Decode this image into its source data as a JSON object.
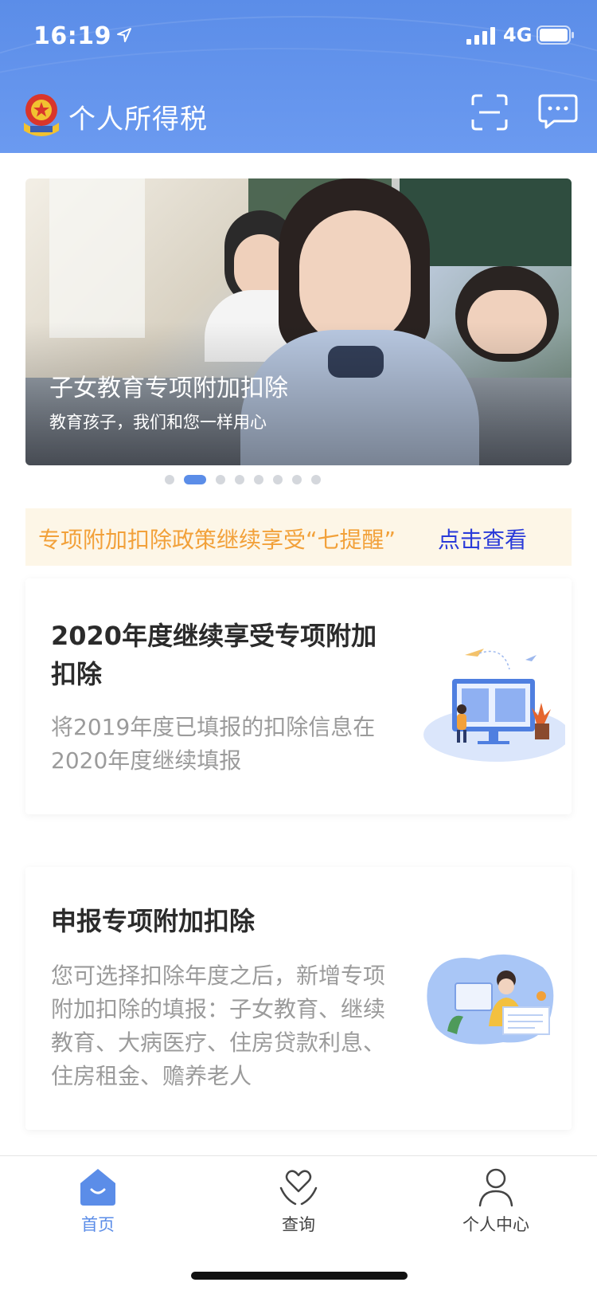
{
  "status_bar": {
    "time": "16:19",
    "network": "4G"
  },
  "app_bar": {
    "title": "个人所得税",
    "icons": [
      "emblem-icon",
      "scan-icon",
      "message-icon"
    ]
  },
  "banner": {
    "title": "子女教育专项附加扣除",
    "subtitle": "教育孩子，我们和您一样用心",
    "slide_count": 8,
    "active_slide_index": 1
  },
  "notice": {
    "text": "专项附加扣除政策继续享受“七提醒”",
    "link": "点击查看"
  },
  "cards": [
    {
      "title": "2020年度继续享受专项附加扣除",
      "description": "将2019年度已填报的扣除信息在2020年度继续填报"
    },
    {
      "title": "申报专项附加扣除",
      "description": "您可选择扣除年度之后，新增专项附加扣除的填报：子女教育、继续教育、大病医疗、住房贷款利息、住房租金、赡养老人"
    }
  ],
  "tab_bar": {
    "tabs": [
      {
        "label": "首页",
        "icon": "home-icon",
        "active": true
      },
      {
        "label": "查询",
        "icon": "heart-hands-icon",
        "active": false
      },
      {
        "label": "个人中心",
        "icon": "person-icon",
        "active": false
      }
    ]
  },
  "colors": {
    "brand_blue": "#5b8de8",
    "notice_bg": "#fdf6e7",
    "notice_text": "#f2a13a",
    "link": "#2a3bd9"
  }
}
